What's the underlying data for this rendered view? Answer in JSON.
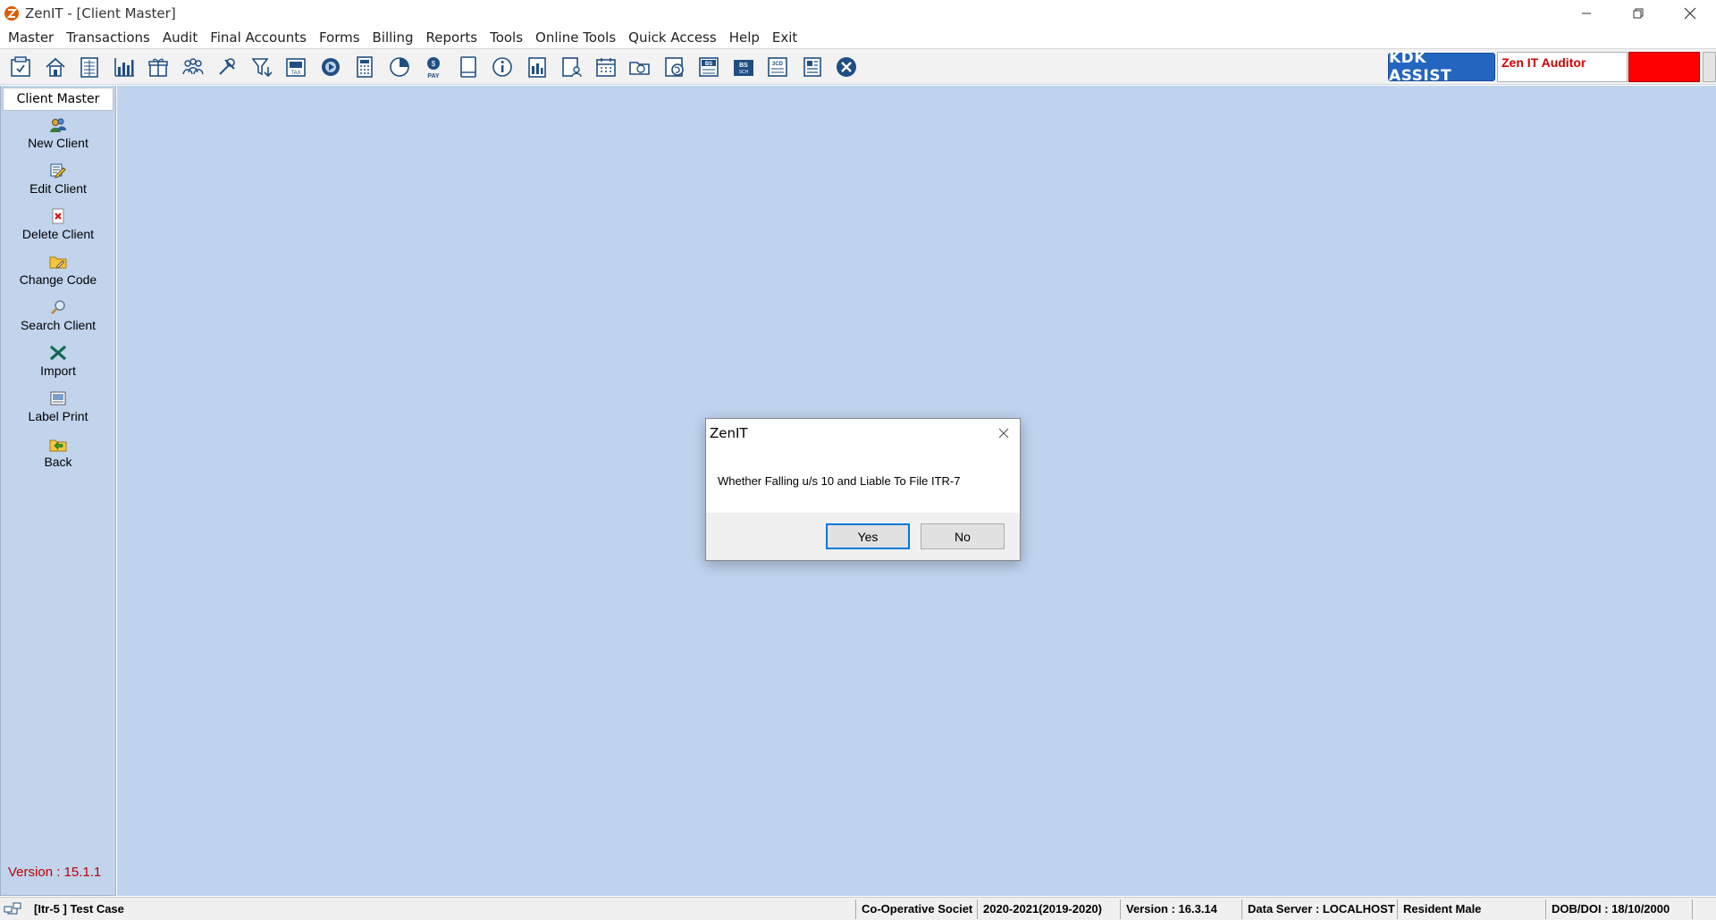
{
  "window": {
    "title": "ZenIT - [Client Master]"
  },
  "menu": [
    "Master",
    "Transactions",
    "Audit",
    "Final Accounts",
    "Forms",
    "Billing",
    "Reports",
    "Tools",
    "Online Tools",
    "Quick Access",
    "Help",
    "Exit"
  ],
  "toolbar": {
    "icons": [
      "report-icon",
      "home-icon",
      "ledger-icon",
      "chart-icon",
      "gift-icon",
      "group-icon",
      "tools-icon",
      "filter-icon",
      "tax-icon",
      "media-icon",
      "calculator-icon",
      "pie-icon",
      "pay-icon",
      "tablet-icon",
      "info-icon",
      "summary-icon",
      "person-doc-icon",
      "calendar-icon",
      "folder-camera-icon",
      "refresh-icon",
      "bs-icon",
      "bs-sch-icon",
      "3cd-icon",
      "notes-icon",
      "close-circle-icon"
    ],
    "kdk_label": "KDK ASSIST",
    "auditor_text": "Zen IT Auditor"
  },
  "sidepanel": {
    "header": "Client Master",
    "items": [
      {
        "label": "New Client",
        "icon": "users-icon"
      },
      {
        "label": "Edit Client",
        "icon": "edit-icon"
      },
      {
        "label": "Delete Client",
        "icon": "delete-icon"
      },
      {
        "label": "Change Code",
        "icon": "folder-edit-icon"
      },
      {
        "label": "Search Client",
        "icon": "search-icon"
      },
      {
        "label": "Import",
        "icon": "excel-icon"
      },
      {
        "label": "Label Print",
        "icon": "label-icon"
      },
      {
        "label": "Back",
        "icon": "back-icon"
      }
    ],
    "version": "Version : 15.1.1"
  },
  "dialog": {
    "title": "ZenIT",
    "message": "Whether Falling u/s 10 and Liable To File ITR-7",
    "yes_label": "Yes",
    "no_label": "No"
  },
  "statusbar": {
    "client": "[Itr-5 ] Test Case",
    "status": "Co-Operative Societ",
    "year": "2020-2021(2019-2020)",
    "version": "Version : 16.3.14",
    "server": "Data Server : LOCALHOST",
    "residency": "Resident Male",
    "dob": "DOB/DOI : 18/10/2000"
  },
  "colors": {
    "background": "#bfd3ed",
    "kdk_blue": "#2266c0",
    "alert_red": "#ff0000",
    "version_red": "#c00000"
  }
}
